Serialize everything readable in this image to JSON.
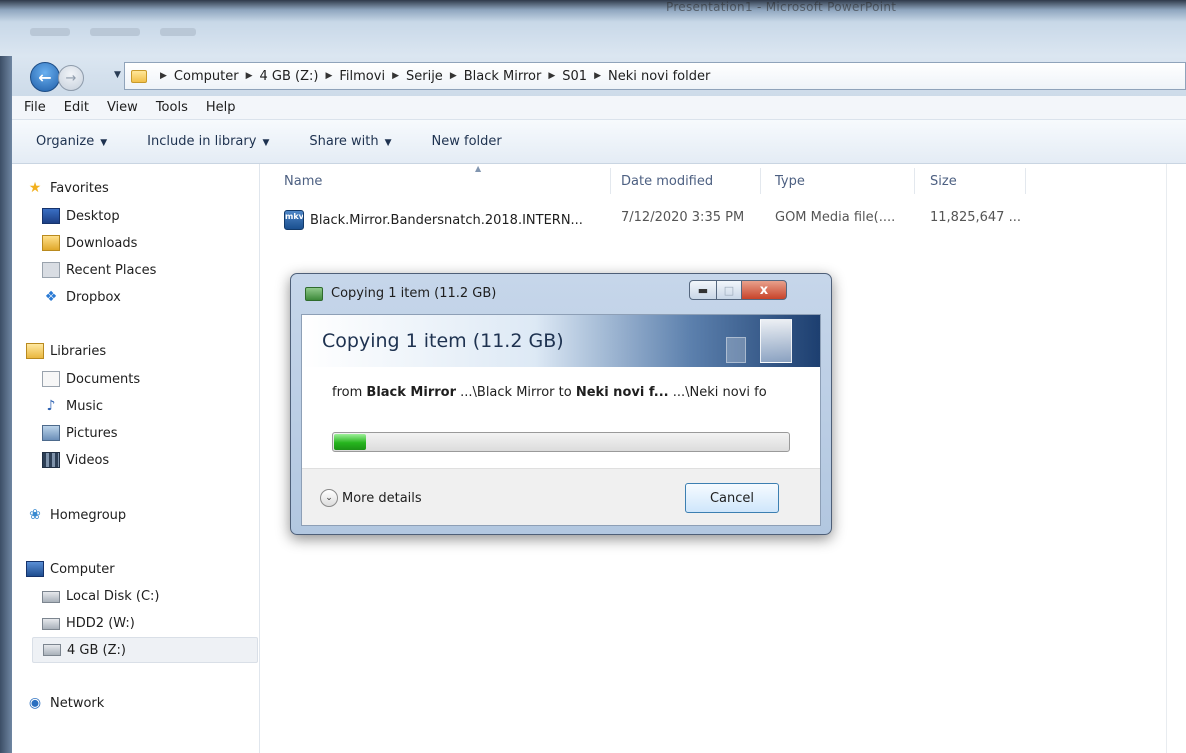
{
  "window": {
    "title": "Presentation1 - Microsoft PowerPoint"
  },
  "address_bar": {
    "crumbs": [
      "Computer",
      "4 GB (Z:)",
      "Filmovi",
      "Serije",
      "Black Mirror",
      "S01",
      "Neki novi folder"
    ]
  },
  "menu": {
    "items": [
      "File",
      "Edit",
      "View",
      "Tools",
      "Help"
    ]
  },
  "toolbar": {
    "organize": "Organize",
    "include_in_library": "Include in library",
    "share_with": "Share with",
    "new_folder": "New folder"
  },
  "nav_pane": {
    "favorites": "Favorites",
    "desktop": "Desktop",
    "downloads": "Downloads",
    "recent_places": "Recent Places",
    "dropbox": "Dropbox",
    "libraries": "Libraries",
    "documents": "Documents",
    "music": "Music",
    "pictures": "Pictures",
    "videos": "Videos",
    "homegroup": "Homegroup",
    "computer": "Computer",
    "local_disk": "Local Disk (C:)",
    "hdd2": "HDD2 (W:)",
    "drive_4gb": "4 GB  (Z:)",
    "network": "Network"
  },
  "file_list": {
    "columns": {
      "name": "Name",
      "date_modified": "Date modified",
      "type": "Type",
      "size": "Size"
    },
    "rows": [
      {
        "icon_text": "mkv",
        "name": "Black.Mirror.Bandersnatch.2018.INTERN...",
        "date_modified": "7/12/2020 3:35 PM",
        "type": "GOM Media file(....",
        "size": "11,825,647 ..."
      }
    ]
  },
  "copy_dialog": {
    "title": "Copying 1 item (11.2 GB)",
    "heading": "Copying 1 item (11.2 GB)",
    "from_label": "from",
    "from_name": "Black Mirror",
    "from_path": "...\\Black Mirror",
    "to_label": "to",
    "to_name": "Neki novi f...",
    "to_path": "...\\Neki novi fo",
    "progress_fraction": 0.07,
    "more_details": "More details",
    "cancel": "Cancel",
    "close_glyph": "x"
  },
  "icons": {
    "back": "back-arrow-icon",
    "forward": "forward-arrow-icon",
    "favorites": "star-icon",
    "dropbox": "dropbox-icon",
    "libraries": "library-icon",
    "homegroup": "homegroup-icon",
    "computer": "computer-icon",
    "network": "network-icon"
  }
}
